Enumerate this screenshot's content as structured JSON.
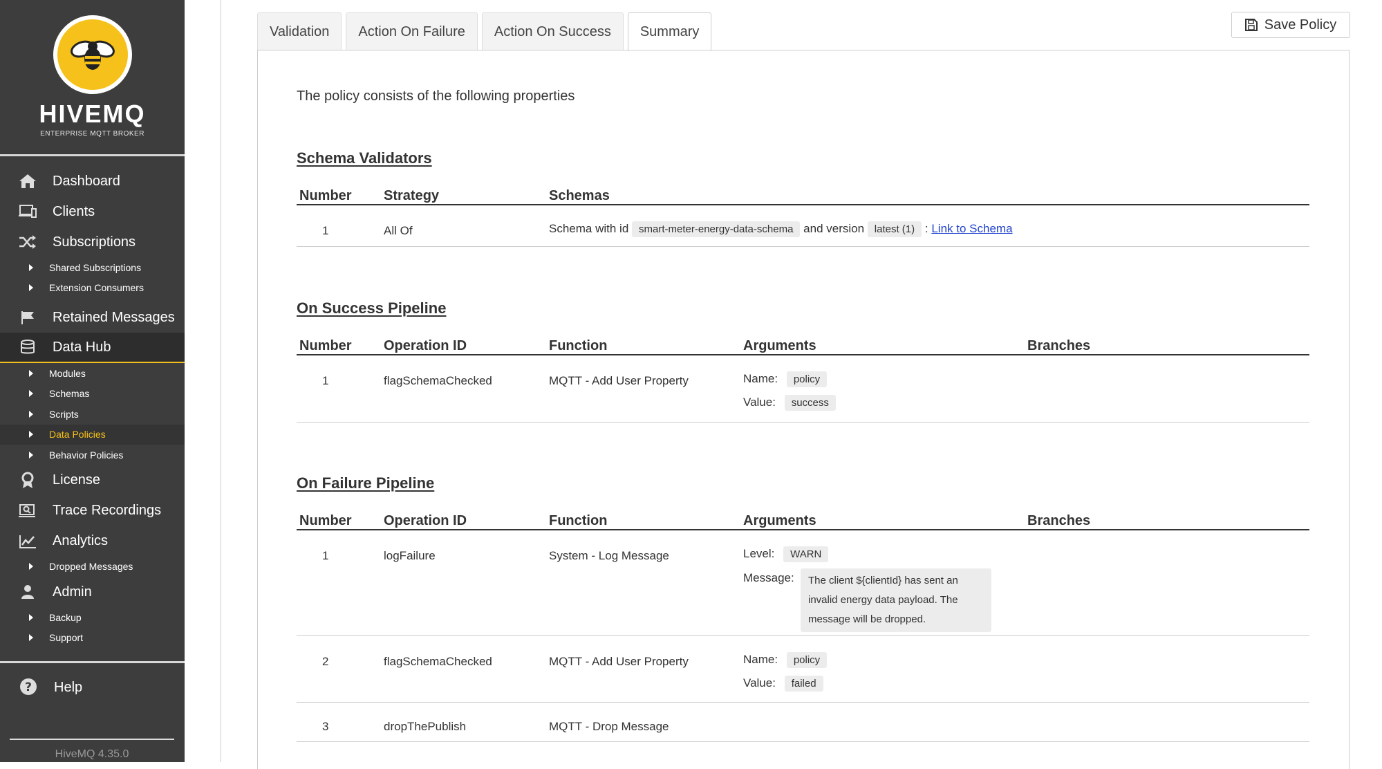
{
  "brand": {
    "name": "HIVEMQ",
    "subtitle": "ENTERPRISE MQTT BROKER",
    "version": "HiveMQ 4.35.0"
  },
  "colors": {
    "sidebar_bg": "#3d3d3d",
    "accent": "#f5c11a"
  },
  "sidebar": {
    "dashboard": "Dashboard",
    "clients": "Clients",
    "subscriptions": "Subscriptions",
    "shared_subscriptions": "Shared Subscriptions",
    "extension_consumers": "Extension Consumers",
    "retained_messages": "Retained Messages",
    "data_hub": "Data Hub",
    "modules": "Modules",
    "schemas": "Schemas",
    "scripts": "Scripts",
    "data_policies": "Data Policies",
    "behavior_policies": "Behavior Policies",
    "license": "License",
    "trace_recordings": "Trace Recordings",
    "analytics": "Analytics",
    "dropped_messages": "Dropped Messages",
    "admin": "Admin",
    "backup": "Backup",
    "support": "Support",
    "help": "Help"
  },
  "tabs": {
    "validation": "Validation",
    "action_on_failure": "Action On Failure",
    "action_on_success": "Action On Success",
    "summary": "Summary"
  },
  "save_label": "Save Policy",
  "intro": "The policy consists of the following properties",
  "schema_validators": {
    "title": "Schema Validators",
    "headers": {
      "number": "Number",
      "strategy": "Strategy",
      "schemas": "Schemas"
    },
    "row": {
      "number": "1",
      "strategy": "All Of",
      "prefix": "Schema with id",
      "schema_id": "smart-meter-energy-data-schema",
      "mid": "and version",
      "version": "latest (1)",
      "sep": ":",
      "link": "Link to Schema"
    }
  },
  "table_headers": {
    "number": "Number",
    "operation_id": "Operation ID",
    "function": "Function",
    "arguments": "Arguments",
    "branches": "Branches"
  },
  "on_success": {
    "title": "On Success Pipeline",
    "row1": {
      "number": "1",
      "op": "flagSchemaChecked",
      "fn": "MQTT - Add User Property",
      "name_label": "Name:",
      "name_value": "policy",
      "value_label": "Value:",
      "value_value": "success"
    }
  },
  "on_failure": {
    "title": "On Failure Pipeline",
    "row1": {
      "number": "1",
      "op": "logFailure",
      "fn": "System - Log Message",
      "level_label": "Level:",
      "level_value": "WARN",
      "message_label": "Message:",
      "message_value": "The client ${clientId} has sent an invalid energy data payload. The message will be dropped."
    },
    "row2": {
      "number": "2",
      "op": "flagSchemaChecked",
      "fn": "MQTT - Add User Property",
      "name_label": "Name:",
      "name_value": "policy",
      "value_label": "Value:",
      "value_value": "failed"
    },
    "row3": {
      "number": "3",
      "op": "dropThePublish",
      "fn": "MQTT - Drop Message"
    }
  }
}
